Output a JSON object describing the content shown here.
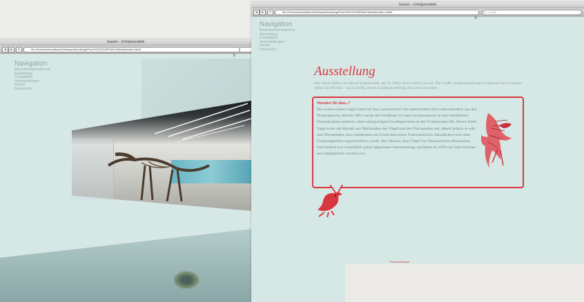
{
  "left_window": {
    "title": "Saurier – Erfolgsmodelle",
    "url": "file:///Users/nelsonfritsch/Desktop/Advertising/Prize%2510%20FINAL/Website/index.html#",
    "nav_title": "Navigation",
    "nav_items": [
      "Besucherinformationen",
      "Ausstellung",
      "Fotogallerie",
      "Veranstaltungen",
      "Presse",
      "Impressum"
    ]
  },
  "right_window": {
    "title": "Saurier – Erfolgsmodelle",
    "url": "file:///Users/nelsonfritsch/Desktop/Advertising/Prize%2510%20FINAL/Website/index.html#",
    "search_placeholder": "Google",
    "nav_title": "Navigation",
    "nav_items": [
      "Besucherinformationen",
      "Ausstellung",
      "Fotogallerie",
      "Veranstaltungen",
      "Presse",
      "Impressum"
    ],
    "heading": "Ausstellung",
    "intro": "Seit Jahren haben wir darauf hingearbeitet, am 31. März ist es endlich soweit: Die Große Landesausstellung im Museum am Löwentor öffnet ihre Pforten – nach dreißig Jahren Landesausstellung die erste von einem",
    "callout_title": "Wussten Sie dass..?",
    "callout_text": "Die ersten echten Vögel schon im Jura auftauchten? Sie entwickelten sich wahrscheinlich aus den Maniraptoren. Bereits 1861 wurde der berühmte Urvogel Archaeopteryx in den Solnhofener Plattenkalken entdeckt, einer einzigartigen Fossillagerstätte in der Fränkischen Alb. Dieser frühe Vogel weist ein Mosaik aus Merkmalen der Vögel und der Theropoden auf, ähnelt jedoch so sehr den Theropoden, dass mindestens ein Fossil ohne klare Federabdrücke fälschlicherweise dem Compsognathus zugeschrieben wurde. Die Theorie, dass Vögel von Dinosauriern abstammen, fand jedoch erst wesentlich später allgemeine Anerkennung, nachdem sie 1970 von John Ostrom neu aufgegriffen worden war.",
    "footer_link": "Veranstaltungen"
  },
  "colors": {
    "page_bg": "#d6e8e6",
    "accent_red": "#d9373f",
    "nav_text": "#95a8a9",
    "body_text": "#8c9fa0"
  },
  "icons": [
    "back-arrow-icon",
    "forward-arrow-icon",
    "add-bookmark-icon",
    "reload-icon",
    "search-icon",
    "archaeopteryx-illustration",
    "red-bird-icon"
  ]
}
